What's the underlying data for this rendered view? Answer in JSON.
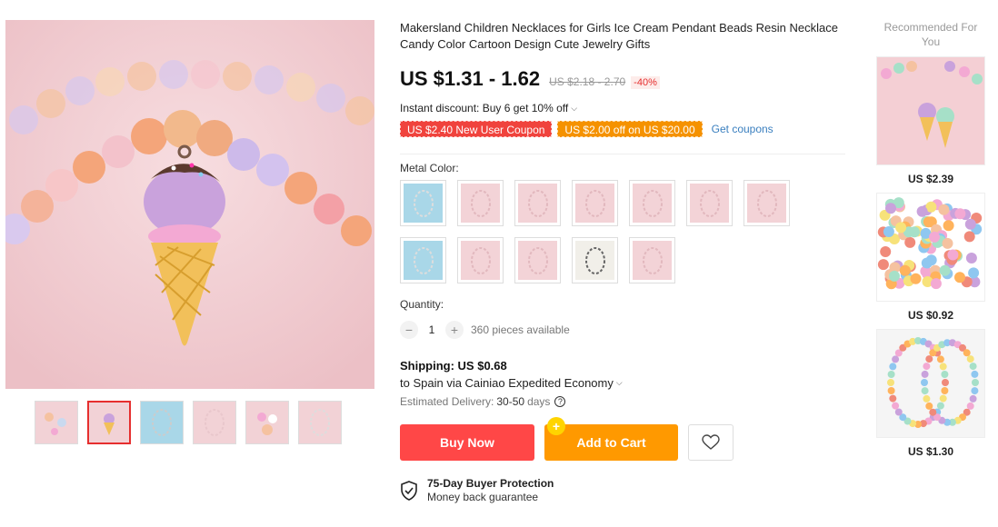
{
  "product": {
    "title": "Makersland Children Necklaces for Girls Ice Cream Pendant Beads Resin Necklace Candy Color Cartoon Design Cute Jewelry Gifts",
    "price": "US $1.31 - 1.62",
    "old_price": "US $2.18 - 2.70",
    "discount": "-40%",
    "instant_discount": "Instant discount: Buy 6 get 10% off",
    "coupons": [
      "US $2.40 New User Coupon",
      "US $2.00 off on US $20.00"
    ],
    "get_coupons": "Get coupons",
    "metal_color_label": "Metal Color:",
    "quantity_label": "Quantity:",
    "quantity": "1",
    "available": "360 pieces available",
    "shipping_title": "Shipping: US $0.68",
    "shipping_to": "to Spain via Cainiao Expedited Economy",
    "estimated_label": "Estimated Delivery:",
    "estimated_value": "30-50",
    "estimated_unit": "days",
    "buy_now": "Buy Now",
    "add_to_cart": "Add to Cart",
    "protection_title": "75-Day Buyer Protection",
    "protection_sub": "Money back guarantee"
  },
  "swatches": [
    "blue",
    "pink",
    "pink",
    "pink",
    "pink",
    "pink",
    "pink",
    "blue",
    "pink",
    "pink",
    "white",
    "pink"
  ],
  "recommended": {
    "title": "Recommended For You",
    "items": [
      {
        "price": "US $2.39"
      },
      {
        "price": "US $0.92"
      },
      {
        "price": "US $1.30"
      }
    ]
  },
  "colors": {
    "accent_red": "#ff4747",
    "accent_orange": "#ff9900",
    "link_blue": "#3a7fbf"
  }
}
